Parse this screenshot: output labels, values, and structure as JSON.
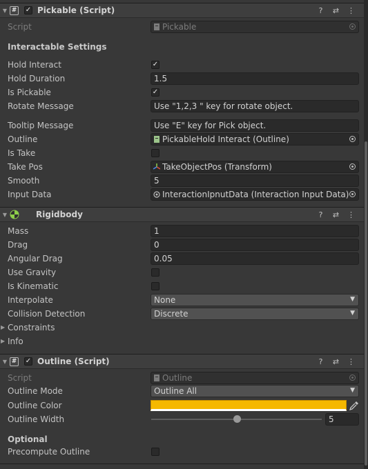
{
  "pickable": {
    "title": "Pickable (Script)",
    "script_label": "Script",
    "script_value": "Pickable",
    "section_title": "Interactable Settings",
    "hold_interact_label": "Hold Interact",
    "hold_interact_checked": true,
    "hold_duration_label": "Hold Duration",
    "hold_duration_value": "1.5",
    "is_pickable_label": "Is Pickable",
    "is_pickable_checked": true,
    "rotate_message_label": "Rotate Message",
    "rotate_message_value": "Use  \"1,2,3 \" key for rotate object.",
    "tooltip_message_label": "Tooltip Message",
    "tooltip_message_value": "Use \"E\" key for Pick object.",
    "outline_label": "Outline",
    "outline_value": "PickableHold Interact (Outline)",
    "is_take_label": "Is Take",
    "is_take_checked": false,
    "take_pos_label": "Take Pos",
    "take_pos_value": "TakeObjectPos (Transform)",
    "smooth_label": "Smooth",
    "smooth_value": "5",
    "input_data_label": "Input Data",
    "input_data_value": "InteractionIpnutData (Interaction Input Data)"
  },
  "rigidbody": {
    "title": "Rigidbody",
    "mass_label": "Mass",
    "mass_value": "1",
    "drag_label": "Drag",
    "drag_value": "0",
    "angular_drag_label": "Angular Drag",
    "angular_drag_value": "0.05",
    "use_gravity_label": "Use Gravity",
    "use_gravity_checked": false,
    "is_kinematic_label": "Is Kinematic",
    "is_kinematic_checked": false,
    "interpolate_label": "Interpolate",
    "interpolate_value": "None",
    "collision_detection_label": "Collision Detection",
    "collision_detection_value": "Discrete",
    "constraints_label": "Constraints",
    "info_label": "Info"
  },
  "outline": {
    "title": "Outline (Script)",
    "script_label": "Script",
    "script_value": "Outline",
    "outline_mode_label": "Outline Mode",
    "outline_mode_value": "Outline All",
    "outline_color_label": "Outline Color",
    "outline_color": "#F5B800",
    "outline_width_label": "Outline Width",
    "outline_width_value": "5",
    "outline_width_slider_fraction": 0.5,
    "optional_title": "Optional",
    "precompute_label": "Precompute Outline",
    "precompute_checked": false
  },
  "icons": {
    "help": "help-icon",
    "presets": "presets-icon",
    "menu": "more-options-icon",
    "picker": "object-picker-icon",
    "eyedropper": "eyedropper-icon"
  },
  "colors": {
    "background": "#383838",
    "header": "#3e3e3e",
    "field": "#2a2a2a",
    "text": "#c4c4c4"
  }
}
